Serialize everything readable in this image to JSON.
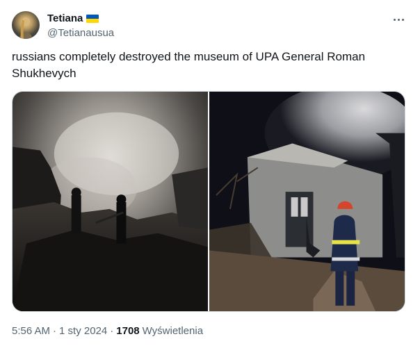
{
  "author": {
    "display_name": "Tetiana",
    "handle": "@Tetianausua",
    "flag_icon": "ukraine-flag-icon"
  },
  "tweet": {
    "text": "russians completely destroyed the museum of UPA General Roman Shukhevych"
  },
  "media": {
    "photo_count": 2
  },
  "meta": {
    "time": "5:56 AM",
    "date": "1 sty 2024",
    "views_count": "1708",
    "views_label": "Wyświetlenia",
    "separator": "·"
  },
  "colors": {
    "text_primary": "#0f1419",
    "text_secondary": "#536471",
    "border": "#cfd9de",
    "flag_blue": "#0057b7",
    "flag_yellow": "#ffd700"
  }
}
